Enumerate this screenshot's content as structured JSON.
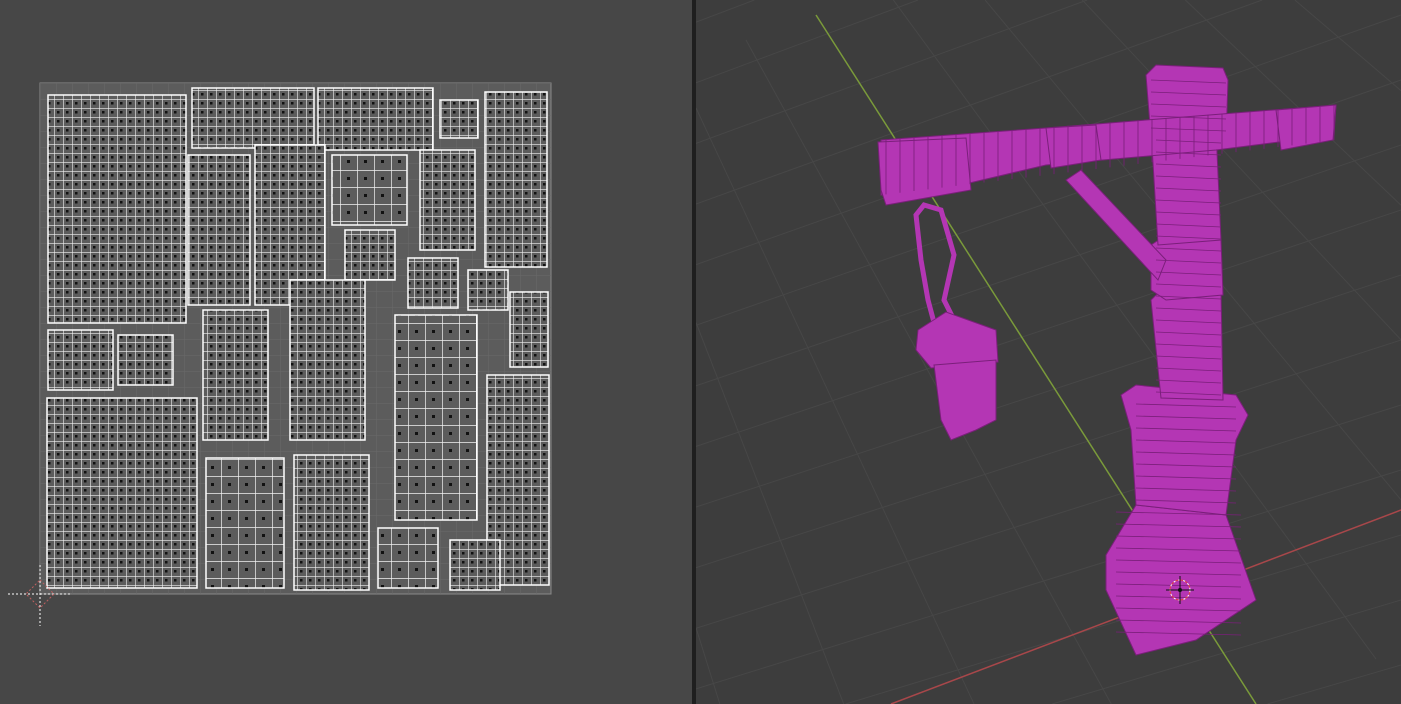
{
  "uv_editor": {
    "background_color": "#474747",
    "uv_space_color": "#5c5c5c",
    "uv_edge_color": "#ffffff",
    "uv_vertex_color": "#000000",
    "cursor_icon": "2d-cursor-icon"
  },
  "viewport": {
    "background_color": "#3d3d3d",
    "grid_color": "#4a4a4a",
    "x_axis_color": "#a8474a",
    "y_axis_color": "#7a9a3a",
    "mesh_color": "#b436b4",
    "wire_color": "#7a1f7a",
    "seam_color": "#e03040",
    "cursor_icon": "3d-cursor-icon"
  }
}
